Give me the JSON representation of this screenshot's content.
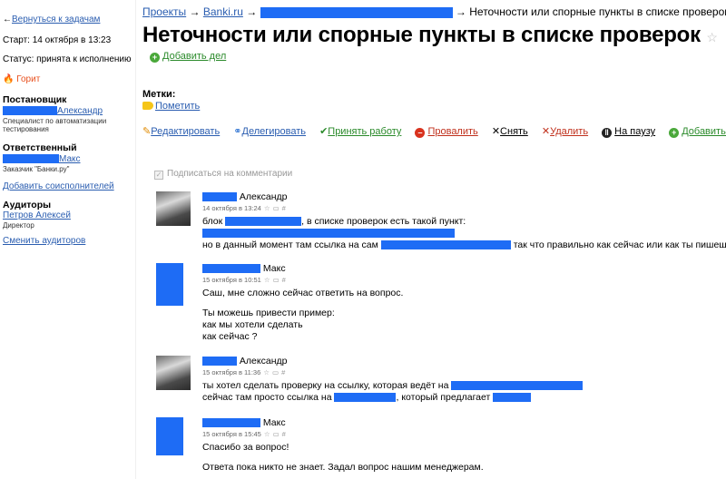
{
  "sidebar": {
    "back_link": "Вернуться к задачам",
    "start": "Старт: 14 октября в 13:23",
    "status": "Статус: принята к исполнению",
    "hot": "Горит",
    "author_heading": "Постановщик",
    "author_name": "Александр",
    "author_role": "Специалист по автоматизации тестирования",
    "responsible_heading": "Ответственный",
    "responsible_name": "Макс",
    "responsible_role": "Заказчик \"Банки.ру\"",
    "add_coexecutors": "Добавить соисполнителей",
    "auditors_heading": "Аудиторы",
    "auditor_name": "Петров Алексей",
    "auditor_role": "Директор",
    "change_auditors": "Сменить аудиторов"
  },
  "breadcrumb": {
    "projects": "Проекты",
    "project": "Banki.ru",
    "current": "Неточности или спорные пункты в списке проверок"
  },
  "page_title": "Неточности или спорные пункты в списке проверок",
  "add_deal": "Добавить дел",
  "tags": {
    "label": "Метки:",
    "mark_link": "Пометить"
  },
  "toolbar": {
    "edit": "Редактировать",
    "delegate": "Делегировать",
    "accept": "Принять работу",
    "fail": "Провалить",
    "remove": "Снять",
    "delete": "Удалить",
    "pause": "На паузу",
    "add_subtask": "Добавить подзадачу"
  },
  "subscribe_label": "Подписаться на комментарии",
  "comments": [
    {
      "name": "Александр",
      "date": "14 октября в 13:24",
      "lines": [
        "блок",
        ", в списке проверок есть такой пункт:",
        "но в данный момент там ссылка на сам",
        " так что правильно как сейчас или как ты пишешь?"
      ]
    },
    {
      "name": "Макс",
      "date": "15 октября в 10:51",
      "lines": [
        "Саш, мне сложно сейчас ответить на вопрос.",
        "Ты можешь привести пример:",
        "как мы хотели сделать",
        "как сейчас ?"
      ]
    },
    {
      "name": "Александр",
      "date": "15 октября в 11:36",
      "lines": [
        "ты хотел сделать проверку на ссылку, которая ведёт на",
        "сейчас там просто ссылка на",
        ", который предлагает"
      ]
    },
    {
      "name": "Макс",
      "date": "15 октября в 15:45",
      "lines": [
        "Спасибо за вопрос!",
        "Ответа пока никто не знает. Задал вопрос нашим менеджерам."
      ]
    }
  ],
  "colors": {
    "link": "#2a5db0",
    "redaction": "#1e6cf5",
    "hot": "#e8501e",
    "green": "#2a8a2a"
  }
}
